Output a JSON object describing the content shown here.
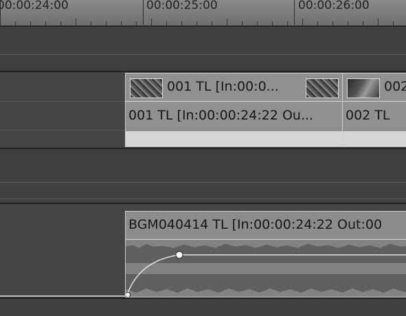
{
  "ruler": {
    "labels": [
      "00:00:24:00",
      "00:00:25:00",
      "00:00:26:00"
    ]
  },
  "video_track": {
    "thumbnail_clips": [
      {
        "label": "001  TL [In:00:0..."
      },
      {
        "label": "002"
      }
    ],
    "name_clips": [
      {
        "label": "001  TL [In:00:00:24:22 Ou..."
      },
      {
        "label": "002  TL"
      }
    ]
  },
  "audio_track": {
    "clip_label": "BGM040414  TL [In:00:00:24:22 Out:00"
  },
  "colors": {
    "background": "#3c3c3c",
    "clip": "#8e8e8e",
    "waveform": "#6a6a6a"
  }
}
